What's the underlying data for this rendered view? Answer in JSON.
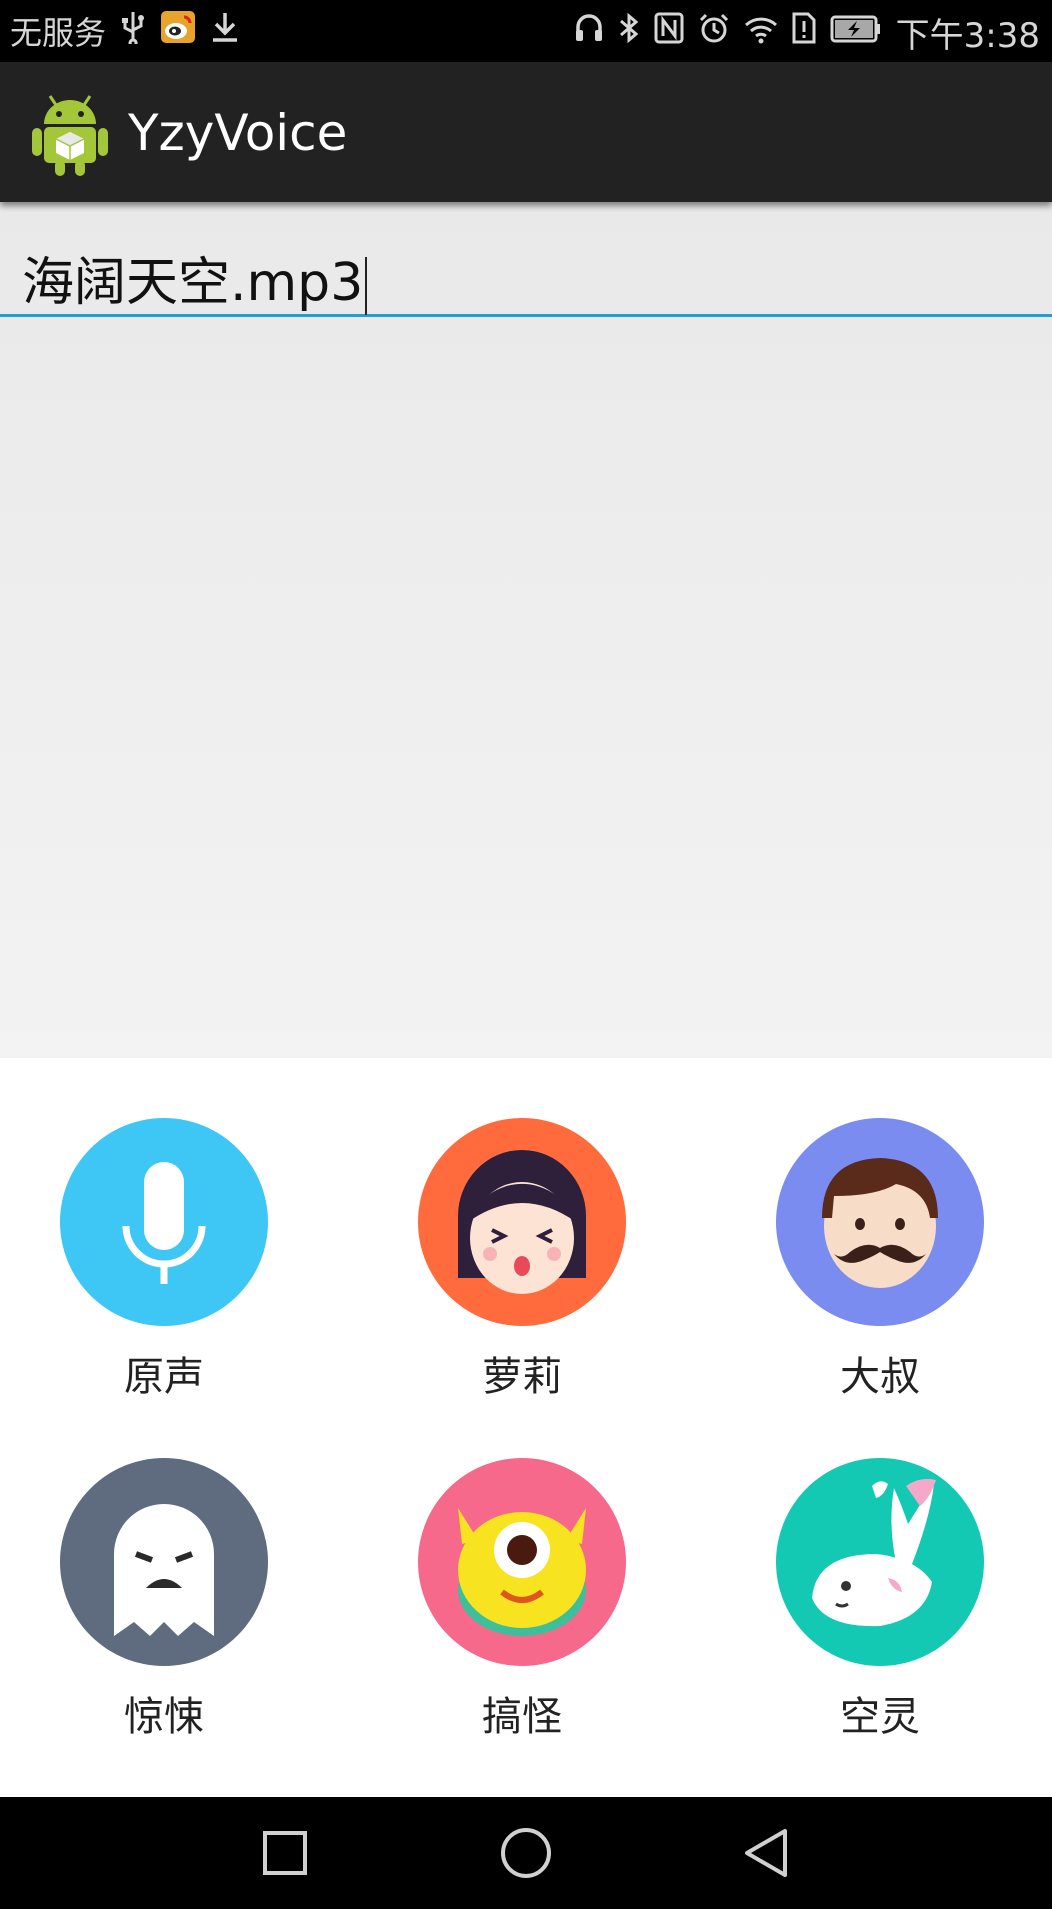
{
  "status_bar": {
    "carrier": "无服务",
    "time": "下午3:38"
  },
  "action_bar": {
    "title": "YzyVoice"
  },
  "file_input": {
    "value": "海阔天空.mp3"
  },
  "effects": [
    {
      "label": "原声",
      "color": "#3ec7f5",
      "icon": "microphone-icon"
    },
    {
      "label": "萝莉",
      "color": "#ff6b3d",
      "icon": "girl-face-icon"
    },
    {
      "label": "大叔",
      "color": "#7a8cf0",
      "icon": "mustache-man-icon"
    },
    {
      "label": "惊悚",
      "color": "#5f6c80",
      "icon": "ghost-icon"
    },
    {
      "label": "搞怪",
      "color": "#f6698a",
      "icon": "one-eyed-monster-icon"
    },
    {
      "label": "空灵",
      "color": "#13c9b3",
      "icon": "fish-icon"
    }
  ],
  "nav_bar": {
    "buttons": [
      "recent-apps-icon",
      "home-icon",
      "back-icon"
    ]
  }
}
